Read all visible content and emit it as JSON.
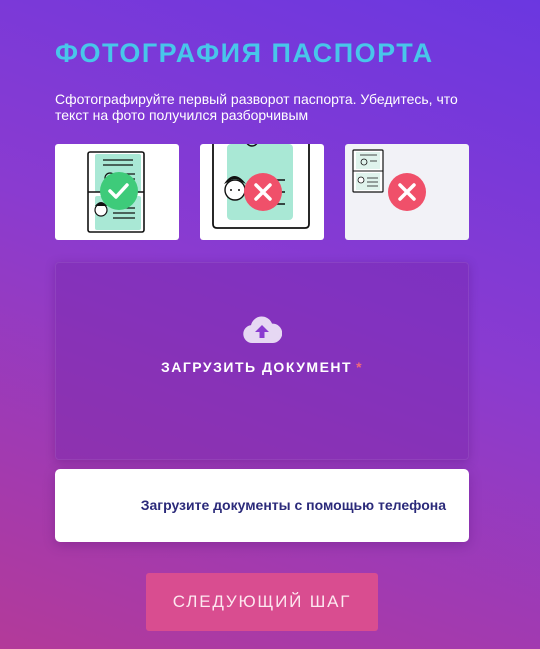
{
  "page": {
    "title": "ФОТОГРАФИЯ ПАСПОРТА",
    "subtitle": "Сфотографируйте первый разворот паспорта. Убедитесь, что текст на фото получился разборчивым"
  },
  "examples": [
    {
      "name": "correct-example",
      "status": "check-icon"
    },
    {
      "name": "too-close-example",
      "status": "cross-icon"
    },
    {
      "name": "too-far-example",
      "status": "cross-icon"
    }
  ],
  "colors": {
    "title": "#48c6ea",
    "accent": "#d94d90",
    "ok": "#3ecb7a",
    "error": "#f0506a"
  },
  "upload": {
    "icon": "cloud-upload-icon",
    "label": "ЗАГРУЗИТЬ ДОКУМЕНТ",
    "required_mark": "*"
  },
  "phone": {
    "label": "Загрузите документы с помощью телефона"
  },
  "next_button": {
    "label": "СЛЕДУЮЩИЙ ШАГ"
  }
}
